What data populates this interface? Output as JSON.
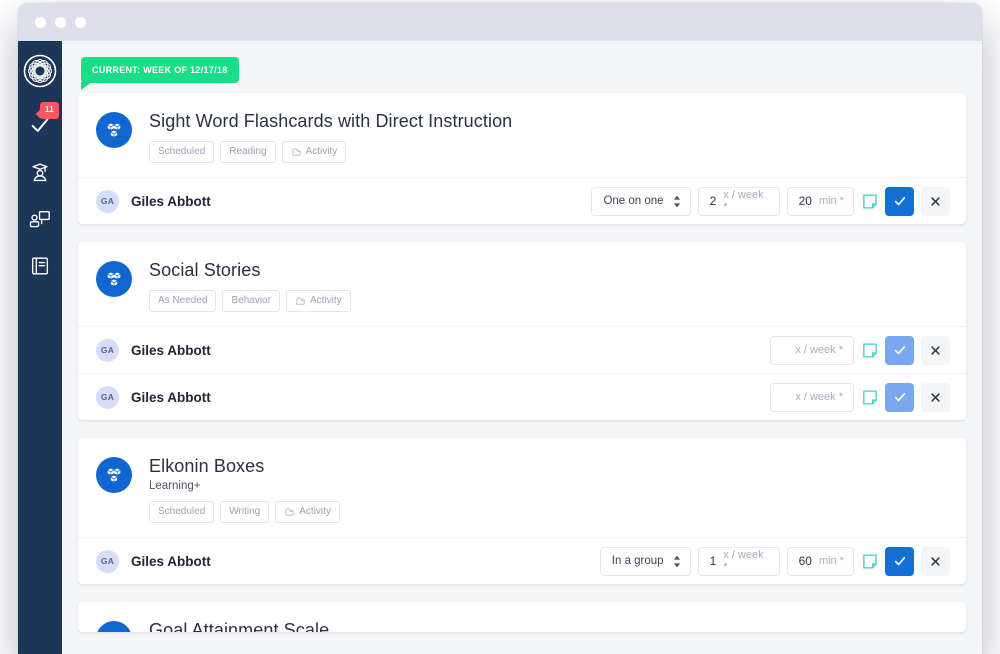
{
  "window": {
    "dots": [
      "close-dot",
      "minimize-dot",
      "maximize-dot"
    ]
  },
  "sidebar": {
    "logo_name": "app-logo",
    "items": [
      {
        "icon": "checkmark-icon",
        "badge": "11",
        "label": "Tasks"
      },
      {
        "icon": "graduate-student-icon",
        "badge": "",
        "label": "Students"
      },
      {
        "icon": "presentation-person-icon",
        "badge": "",
        "label": "Sessions"
      },
      {
        "icon": "book-icon",
        "badge": "",
        "label": "Library"
      }
    ]
  },
  "banner": {
    "current_week_label": "CURRENT: WEEK OF 12/17/18",
    "accent_color": "#19dd87"
  },
  "colors": {
    "sidebar": "#1d3557",
    "primary_blue": "#1470d6",
    "icon_blue": "#1166cf",
    "muted_blue": "#7aa8ee",
    "badge_red": "#f9595f",
    "note_teal": "#3fd0c9"
  },
  "controls_meta": {
    "note_icon": "note-icon",
    "confirm_icon": "checkmark-icon",
    "remove_icon": "close-icon",
    "stepper_icon": "stepper-updown-icon",
    "activity_icon": "activity-puzzle-icon",
    "avatar_name": "avatar"
  },
  "cards": [
    {
      "title": "Sight Word Flashcards with Direct Instruction",
      "subtitle": "",
      "icon": "blocks-icon",
      "tags": [
        {
          "label": "Scheduled",
          "icon": ""
        },
        {
          "label": "Reading",
          "icon": ""
        },
        {
          "label": "Activity",
          "icon": "activity-puzzle-icon"
        }
      ],
      "rows": [
        {
          "initials": "GA",
          "name": "Giles Abbott",
          "grouping": "One on one",
          "frequency": "2",
          "frequency_unit": "x / week *",
          "frequency_placeholder": "x / week *",
          "duration": "20",
          "duration_unit": "min *",
          "has_duration": true,
          "confirm_state": "active"
        }
      ]
    },
    {
      "title": "Social Stories",
      "subtitle": "",
      "icon": "blocks-icon",
      "tags": [
        {
          "label": "As Needed",
          "icon": ""
        },
        {
          "label": "Behavior",
          "icon": ""
        },
        {
          "label": "Activity",
          "icon": "activity-puzzle-icon"
        }
      ],
      "rows": [
        {
          "initials": "GA",
          "name": "Giles Abbott",
          "grouping": "",
          "frequency": "",
          "frequency_unit": "",
          "frequency_placeholder": "x / week *",
          "duration": "",
          "duration_unit": "",
          "has_duration": false,
          "confirm_state": "muted"
        },
        {
          "initials": "GA",
          "name": "Giles Abbott",
          "grouping": "",
          "frequency": "",
          "frequency_unit": "",
          "frequency_placeholder": "x / week *",
          "duration": "",
          "duration_unit": "",
          "has_duration": false,
          "confirm_state": "muted"
        }
      ]
    },
    {
      "title": "Elkonin Boxes",
      "subtitle": "Learning+",
      "icon": "blocks-icon",
      "tags": [
        {
          "label": "Scheduled",
          "icon": ""
        },
        {
          "label": "Writing",
          "icon": ""
        },
        {
          "label": "Activity",
          "icon": "activity-puzzle-icon"
        }
      ],
      "rows": [
        {
          "initials": "GA",
          "name": "Giles Abbott",
          "grouping": "In a group",
          "frequency": "1",
          "frequency_unit": "x / week *",
          "frequency_placeholder": "x / week *",
          "duration": "60",
          "duration_unit": "min *",
          "has_duration": true,
          "confirm_state": "active"
        }
      ]
    },
    {
      "title": "Goal Attainment Scale",
      "subtitle": "",
      "icon": "blocks-icon",
      "tags": [],
      "rows": []
    }
  ]
}
